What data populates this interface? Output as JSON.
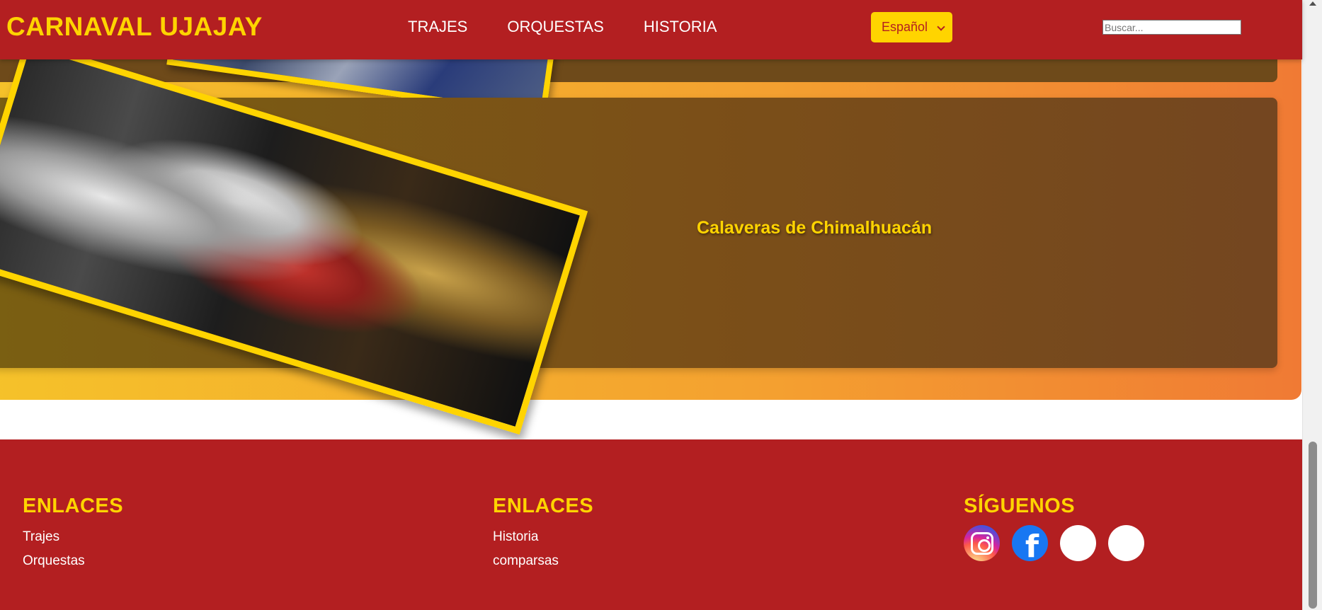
{
  "header": {
    "brand": "CARNAVAL UJAJAY",
    "nav": [
      "TRAJES",
      "ORQUESTAS",
      "HISTORIA"
    ],
    "language": "Español",
    "search_placeholder": "Buscar..."
  },
  "content": {
    "card_title": "Calaveras de Chimalhuacán"
  },
  "footer": {
    "col1": {
      "heading": "ENLACES",
      "links": [
        "Trajes",
        "Orquestas"
      ]
    },
    "col2": {
      "heading": "ENLACES",
      "links": [
        "Historia",
        "comparsas"
      ]
    },
    "col3": {
      "heading": "SÍGUENOS",
      "icons": [
        "instagram-icon",
        "facebook-icon",
        "social-icon-3",
        "social-icon-4"
      ]
    }
  },
  "colors": {
    "header_bg": "#b31f21",
    "accent_yellow": "#ffd400",
    "card_brown": "#7a5a16"
  }
}
